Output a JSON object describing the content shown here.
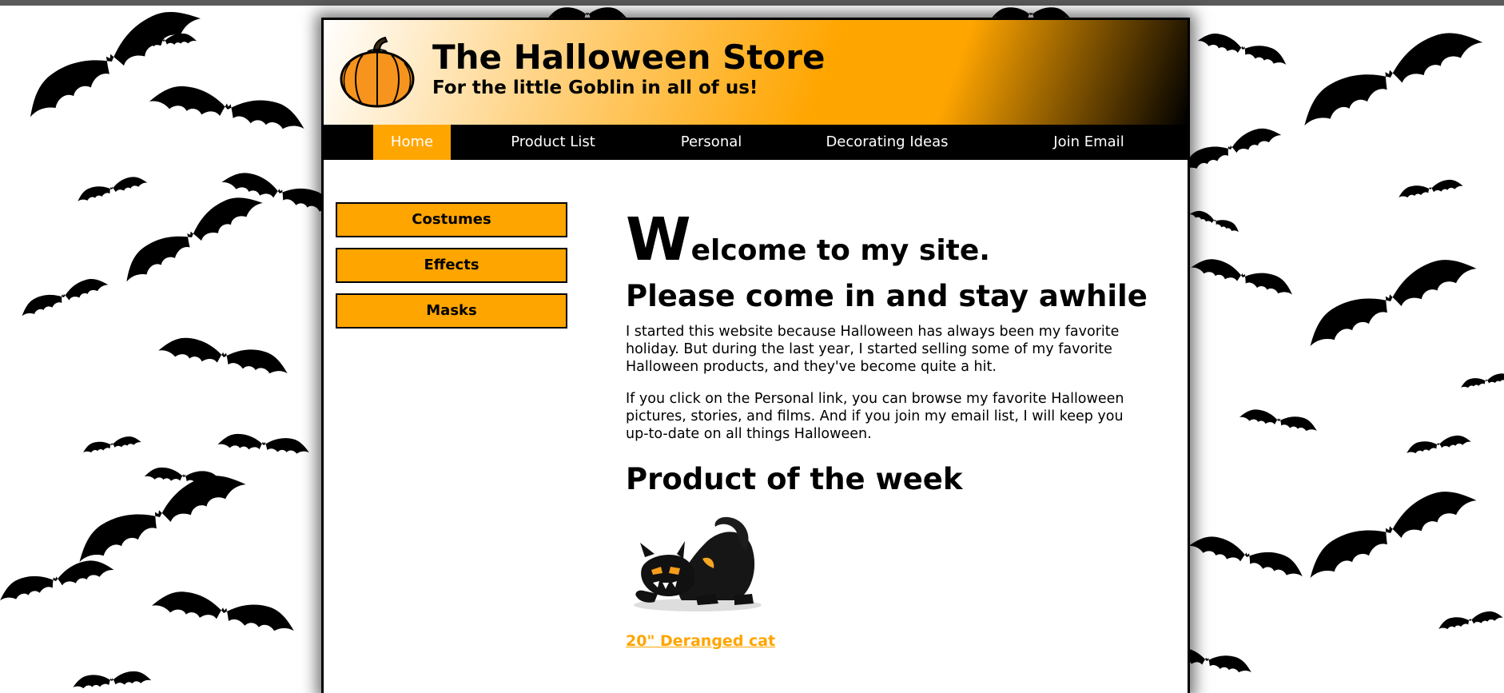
{
  "header": {
    "title": "The Halloween Store",
    "subtitle": "For the little Goblin in all of us!",
    "logo_icon": "pumpkin-icon"
  },
  "nav": {
    "items": [
      {
        "label": "Home",
        "active": true
      },
      {
        "label": "Product List",
        "active": false
      },
      {
        "label": "Personal",
        "active": false
      },
      {
        "label": "Decorating Ideas",
        "active": false
      },
      {
        "label": "Join Email",
        "active": false
      }
    ]
  },
  "sidebar": {
    "items": [
      {
        "label": "Costumes"
      },
      {
        "label": "Effects"
      },
      {
        "label": "Masks"
      }
    ]
  },
  "main": {
    "welcome_initial": "W",
    "welcome_rest": "elcome to my site.",
    "tagline": "Please come in and stay awhile",
    "paragraph1": "I started this website because Halloween has always been my favorite holiday. But during the last year, I started selling some of my favorite Halloween products, and they've become quite a hit.",
    "paragraph2": "If you click on the Personal link, you can browse my favorite Halloween pictures, stories, and films. And if you join my email list, I will keep you up-to-date on all things Halloween.",
    "product_heading": "Product of the week",
    "product_image_icon": "black-cat-image",
    "product_link": "20\" Deranged cat"
  },
  "colors": {
    "accent": "#ffa500",
    "nav_bg": "#000000",
    "text": "#000000",
    "frame_border": "#000000"
  },
  "background_icon": "bat-icon"
}
